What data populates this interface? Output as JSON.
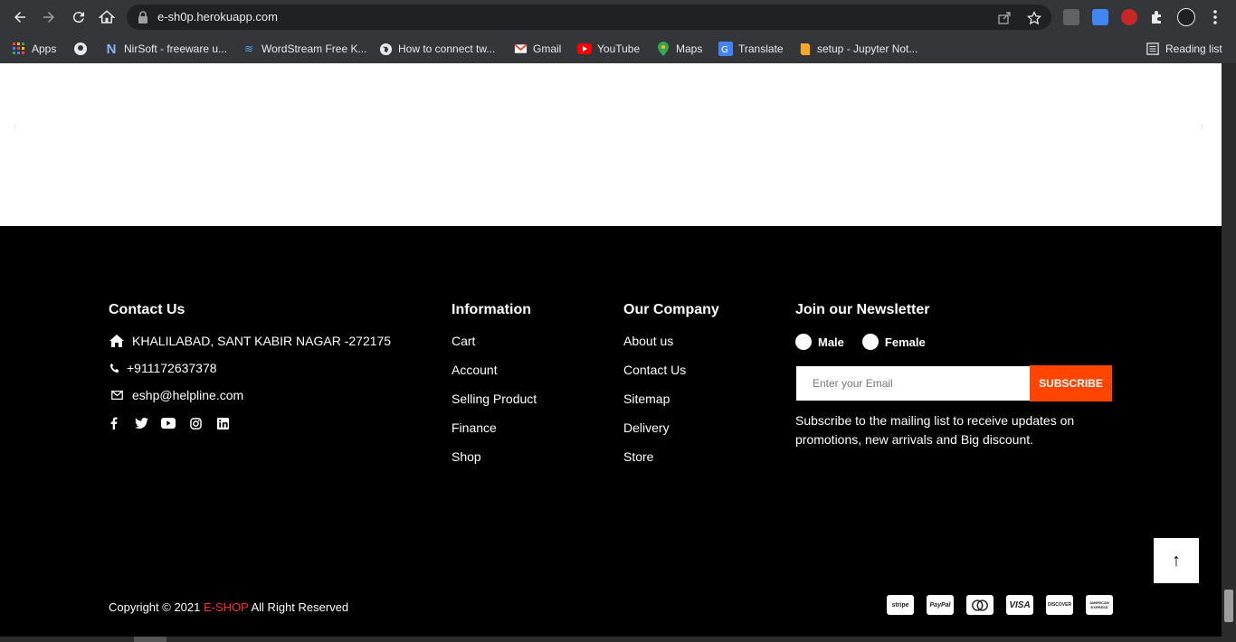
{
  "browser": {
    "url": "e-sh0p.herokuapp.com",
    "reading_list": "Reading list",
    "bookmarks": [
      {
        "label": "Apps",
        "icon": "apps-grid-icon"
      },
      {
        "label": "",
        "icon": "github-icon"
      },
      {
        "label": "NirSoft - freeware u...",
        "icon": "nirsoft-icon"
      },
      {
        "label": "WordStream Free K...",
        "icon": "wordstream-icon"
      },
      {
        "label": "How to connect tw...",
        "icon": "globe-icon"
      },
      {
        "label": "Gmail",
        "icon": "gmail-icon"
      },
      {
        "label": "YouTube",
        "icon": "youtube-icon"
      },
      {
        "label": "Maps",
        "icon": "maps-icon"
      },
      {
        "label": "Translate",
        "icon": "translate-icon"
      },
      {
        "label": "setup - Jupyter Not...",
        "icon": "jupyter-icon"
      }
    ]
  },
  "footer": {
    "contact": {
      "title": "Contact Us",
      "address": "KHALILABAD, SANT KABIR NAGAR -272175",
      "phone": "+911172637378",
      "email": "eshp@helpline.com"
    },
    "information": {
      "title": "Information",
      "links": [
        "Cart",
        "Account",
        "Selling Product",
        "Finance",
        "Shop"
      ]
    },
    "company": {
      "title": "Our Company",
      "links": [
        "About us",
        "Contact Us",
        "Sitemap",
        "Delivery",
        "Store"
      ]
    },
    "newsletter": {
      "title": "Join our Newsletter",
      "male": "Male",
      "female": "Female",
      "email_placeholder": "Enter your Email",
      "subscribe": "SUBSCRIBE",
      "description": "Subscribe to the mailing list to receive updates on promotions, new arrivals and Big discount."
    },
    "copyright": {
      "prefix": "Copyright © 2021",
      "brand": "E-SHOP",
      "suffix": "All Right Reserved"
    },
    "payments": [
      "stripe",
      "PayPal",
      "",
      "VISA",
      "DISCOVER",
      "AMERICAN EXPRESS"
    ],
    "to_top": "↑"
  },
  "colors": {
    "accent": "#ff4500",
    "brand": "#ff2d2d",
    "footer_bg": "#000000"
  }
}
